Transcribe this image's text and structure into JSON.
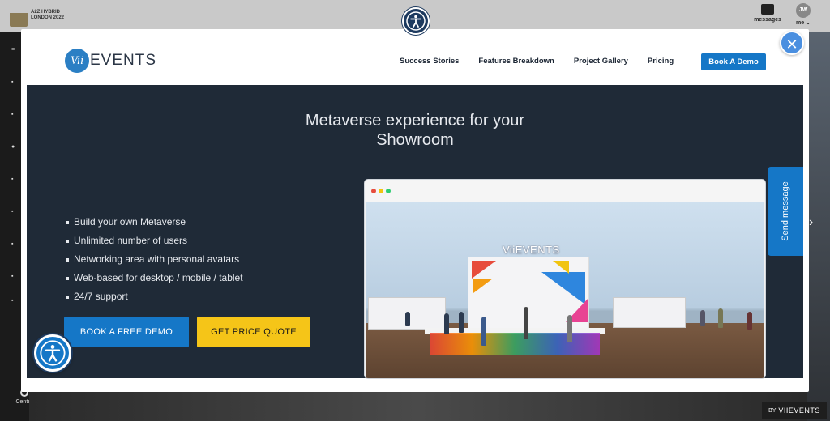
{
  "background": {
    "event_logo": {
      "line1": "A2Z HYBRID",
      "line2": "LONDON 2022"
    },
    "messages_label": "messages",
    "user": {
      "initials": "JW",
      "menu_label": "me"
    },
    "center_label": "Center",
    "by_label": "BY",
    "by_brand": "VIIEVENTS"
  },
  "modal": {
    "close_icon": "close-icon",
    "nav": {
      "brand_mark": "Vii",
      "brand_word": "EVENTS",
      "links": [
        "Success Stories",
        "Features Breakdown",
        "Project Gallery",
        "Pricing"
      ],
      "cta": "Book A Demo"
    },
    "hero": {
      "title_line1": "Metaverse experience for your",
      "title_line2": "Showroom",
      "features": [
        "Build your own Metaverse",
        "Unlimited number of users",
        "Networking area with personal avatars",
        "Web-based for desktop / mobile / tablet",
        "24/7 support"
      ],
      "primary_button": "BOOK A FREE DEMO",
      "secondary_button": "GET PRICE QUOTE",
      "preview_logo": "ViiEVENTS"
    }
  },
  "send_message_label": "Send message",
  "colors": {
    "accent_blue": "#1577c7",
    "quote_yellow": "#f5c518",
    "hero_bg": "#1f2a37"
  }
}
